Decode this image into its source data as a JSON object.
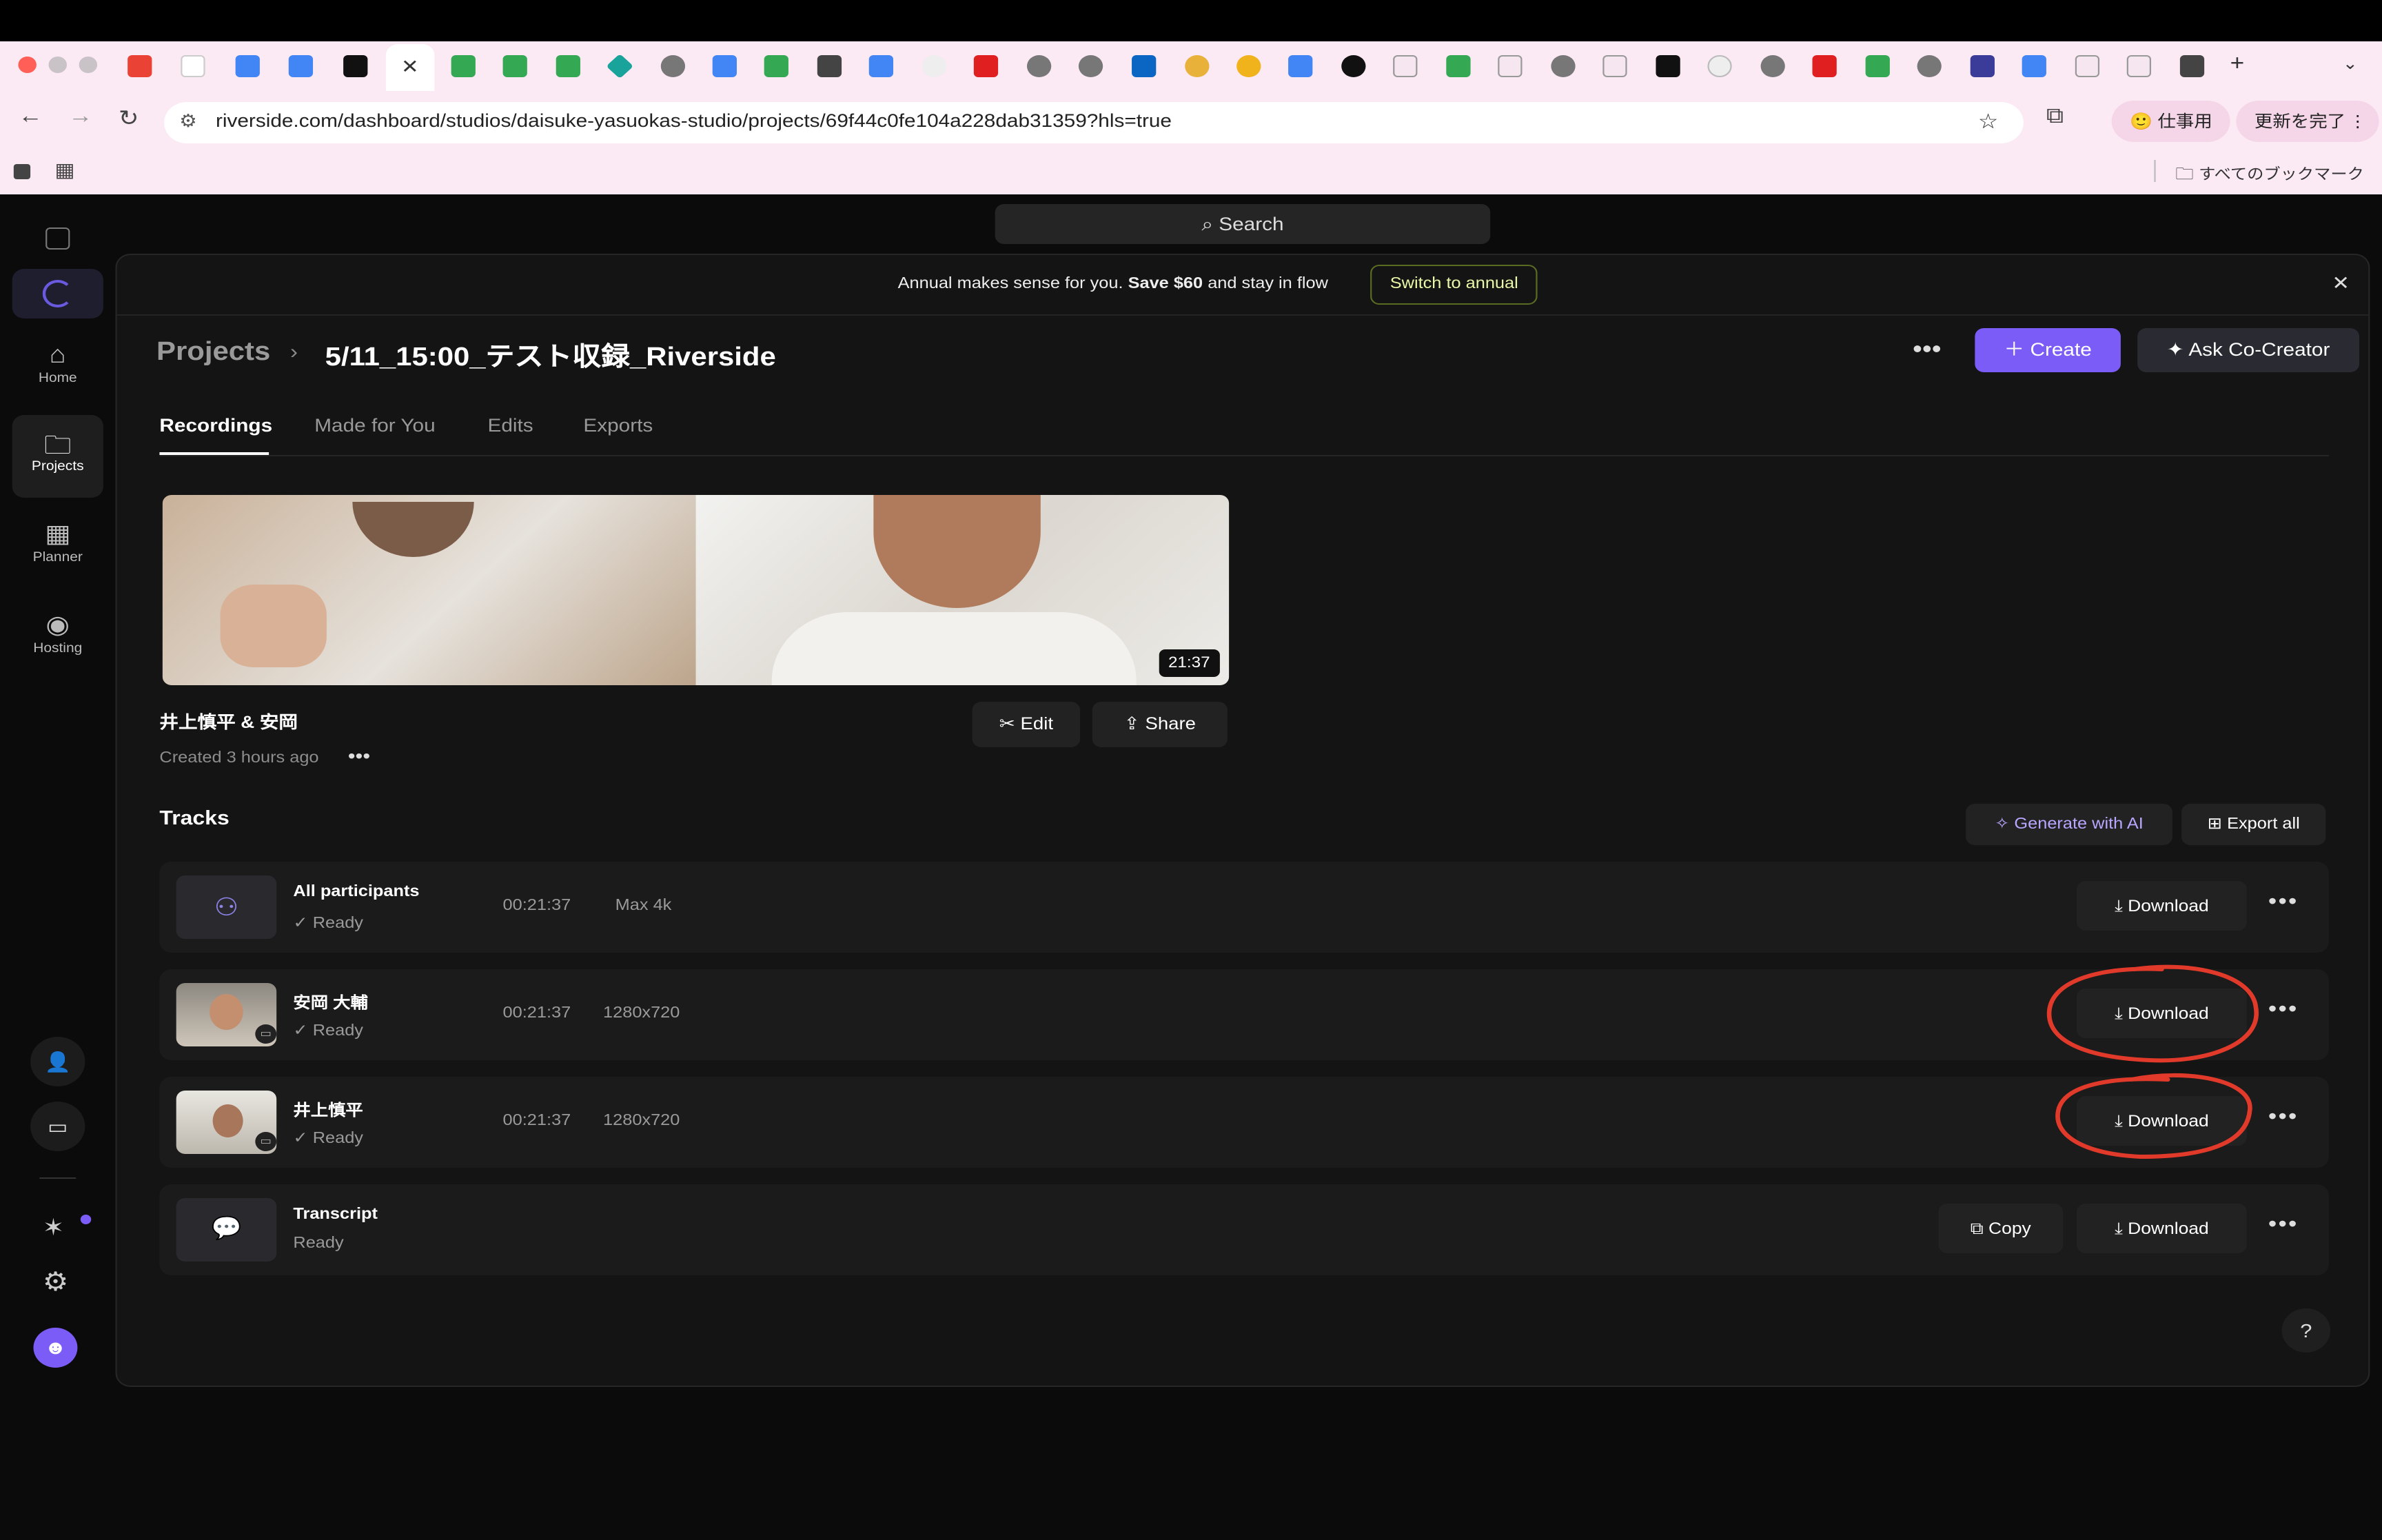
{
  "browser": {
    "url": "riverside.com/dashboard/studios/daisuke-yasuokas-studio/projects/69f44c0fe104a228dab31359?hls=true",
    "profile_label": "仕事用",
    "update_label": "更新を完了",
    "bookmarks_label": "すべてのブックマーク"
  },
  "sidebar": {
    "items": [
      {
        "label": "Home",
        "icon": "home-icon"
      },
      {
        "label": "Projects",
        "icon": "folder-icon"
      },
      {
        "label": "Planner",
        "icon": "calendar-icon"
      },
      {
        "label": "Hosting",
        "icon": "podcast-icon"
      }
    ]
  },
  "search": {
    "placeholder": "Search"
  },
  "banner": {
    "text_a": "Annual makes sense for you.",
    "text_b": "Save $60",
    "text_c": "and stay in flow",
    "cta": "Switch to annual"
  },
  "header": {
    "breadcrumb_root": "Projects",
    "title": "5/11_15:00_テスト収録_Riverside",
    "create_label": "Create",
    "cocreator_label": "Ask Co-Creator"
  },
  "tabs": [
    "Recordings",
    "Made for You",
    "Edits",
    "Exports"
  ],
  "recording": {
    "name": "井上慎平 & 安岡",
    "created": "Created 3 hours ago",
    "duration_badge": "21:37",
    "edit_label": "Edit",
    "share_label": "Share"
  },
  "tracks_section": {
    "title": "Tracks",
    "generate_label": "Generate with AI",
    "export_all_label": "Export all"
  },
  "tracks": [
    {
      "name": "All participants",
      "status": "Ready",
      "duration": "00:21:37",
      "resolution": "Max 4k",
      "download": "Download"
    },
    {
      "name": "安岡 大輔",
      "status": "Ready",
      "duration": "00:21:37",
      "resolution": "1280x720",
      "download": "Download"
    },
    {
      "name": "井上慎平",
      "status": "Ready",
      "duration": "00:21:37",
      "resolution": "1280x720",
      "download": "Download"
    },
    {
      "name": "Transcript",
      "status": "Ready",
      "copy": "Copy",
      "download": "Download"
    }
  ],
  "help_label": "?",
  "colors": {
    "accent": "#7c5cf6",
    "annotation": "#e23a2a",
    "banner_cta": "#e9f7a8"
  }
}
